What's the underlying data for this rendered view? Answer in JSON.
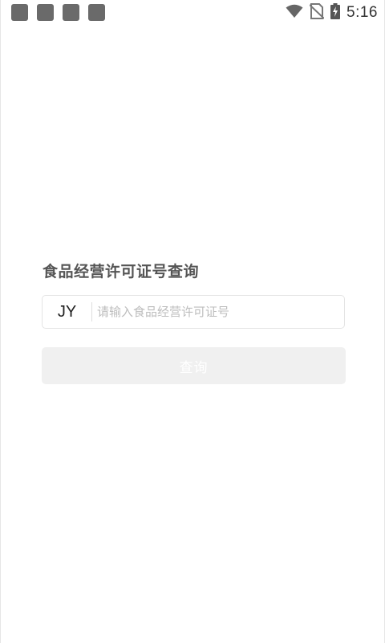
{
  "status_bar": {
    "time": "5:16",
    "notification_icons": [
      "notification-icon",
      "notification-icon",
      "notification-icon",
      "notification-icon"
    ],
    "icons": [
      "wifi-icon",
      "no-sim-icon",
      "battery-charging-icon"
    ]
  },
  "query": {
    "title": "食品经营许可证号查询",
    "prefix": "JY",
    "input_value": "",
    "input_placeholder": "请输入食品经营许可证号",
    "button_label": "查询"
  },
  "colors": {
    "title_text": "#555555",
    "button_disabled_bg": "#f0f0f0",
    "button_text": "#ffffff",
    "placeholder": "#bdbdbd"
  }
}
